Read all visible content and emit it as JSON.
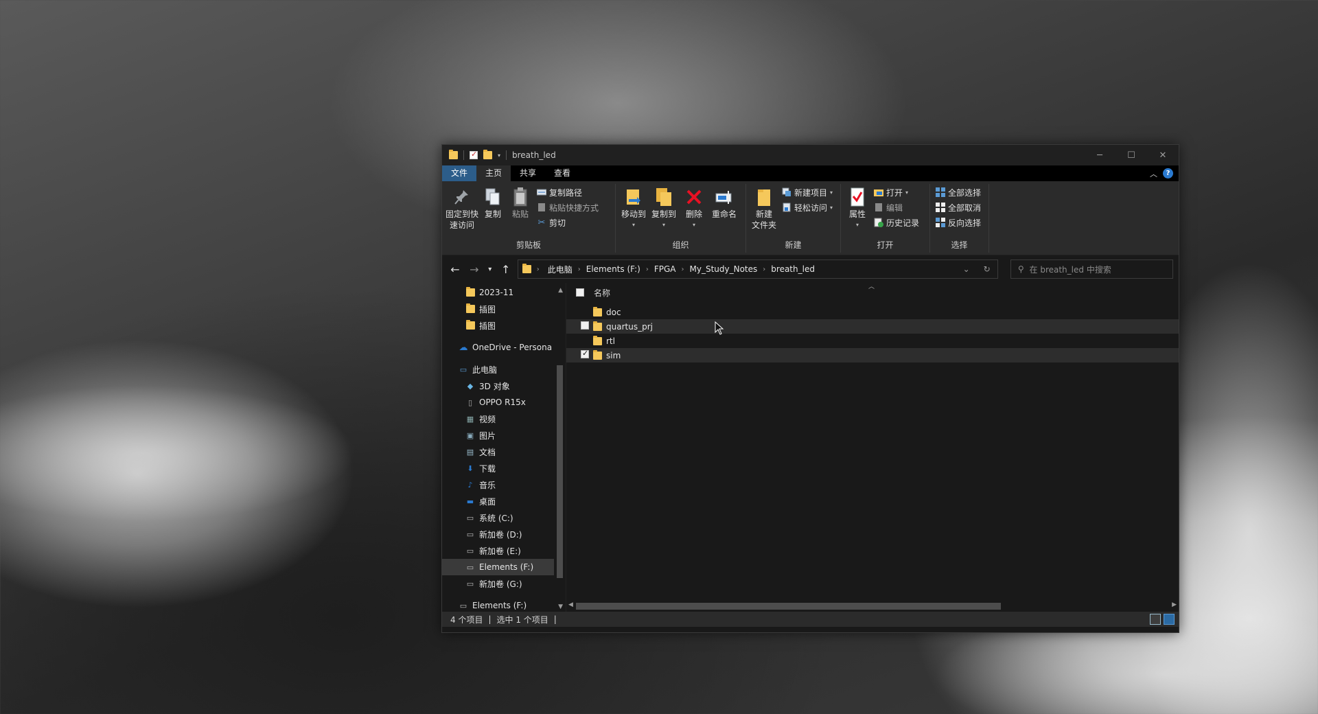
{
  "window": {
    "title": "breath_led",
    "controls": {
      "minimize": "─",
      "maximize": "☐",
      "close": "✕"
    }
  },
  "ribbon_tabs": [
    "文件",
    "主页",
    "共享",
    "查看"
  ],
  "ribbon": {
    "clipboard": {
      "pin": "固定到快速访问",
      "pin_line1": "固定到快",
      "pin_line2": "速访问",
      "copy": "复制",
      "paste": "粘贴",
      "copy_path": "复制路径",
      "paste_shortcut": "粘贴快捷方式",
      "cut": "剪切",
      "label": "剪贴板"
    },
    "organize": {
      "move_to": "移动到",
      "copy_to": "复制到",
      "delete": "删除",
      "rename": "重命名",
      "label": "组织"
    },
    "new": {
      "new_folder_line1": "新建",
      "new_folder_line2": "文件夹",
      "new_item": "新建项目",
      "easy_access": "轻松访问",
      "label": "新建"
    },
    "open": {
      "properties": "属性",
      "open": "打开",
      "edit": "编辑",
      "history": "历史记录",
      "label": "打开"
    },
    "select": {
      "select_all": "全部选择",
      "select_none": "全部取消",
      "invert": "反向选择",
      "label": "选择"
    }
  },
  "address": {
    "crumbs": [
      "此电脑",
      "Elements (F:)",
      "FPGA",
      "My_Study_Notes",
      "breath_led"
    ],
    "search_placeholder": "在 breath_led 中搜索"
  },
  "nav_pane": {
    "items": [
      {
        "label": "2023-11",
        "icon": "folder-icon"
      },
      {
        "label": "插图",
        "icon": "folder-icon"
      },
      {
        "label": "插图",
        "icon": "folder-icon"
      },
      {
        "label": "OneDrive - Persona",
        "icon": "cloud-icon"
      },
      {
        "label": "此电脑",
        "icon": "pc-icon"
      },
      {
        "label": "3D 对象",
        "icon": "cube-icon"
      },
      {
        "label": "OPPO R15x",
        "icon": "phone-icon"
      },
      {
        "label": "视频",
        "icon": "video-icon"
      },
      {
        "label": "图片",
        "icon": "picture-icon"
      },
      {
        "label": "文档",
        "icon": "document-icon"
      },
      {
        "label": "下载",
        "icon": "download-icon"
      },
      {
        "label": "音乐",
        "icon": "music-icon"
      },
      {
        "label": "桌面",
        "icon": "desktop-icon"
      },
      {
        "label": "系统 (C:)",
        "icon": "drive-icon"
      },
      {
        "label": "新加卷 (D:)",
        "icon": "drive-icon"
      },
      {
        "label": "新加卷 (E:)",
        "icon": "drive-icon"
      },
      {
        "label": "Elements (F:)",
        "icon": "drive-icon"
      },
      {
        "label": "新加卷 (G:)",
        "icon": "drive-icon"
      },
      {
        "label": "Elements (F:)",
        "icon": "drive-icon"
      }
    ]
  },
  "file_list": {
    "column_name": "名称",
    "rows": [
      {
        "name": "doc",
        "checked": false,
        "hover": false
      },
      {
        "name": "quartus_prj",
        "checked": false,
        "hover": true
      },
      {
        "name": "rtl",
        "checked": false,
        "hover": false
      },
      {
        "name": "sim",
        "checked": true,
        "hover": true
      }
    ]
  },
  "status": {
    "count": "4 个项目",
    "selected": "选中 1 个项目"
  },
  "colors": {
    "accent": "#2c5d8a",
    "folder": "#f5c85b",
    "delete_red": "#e81123"
  }
}
